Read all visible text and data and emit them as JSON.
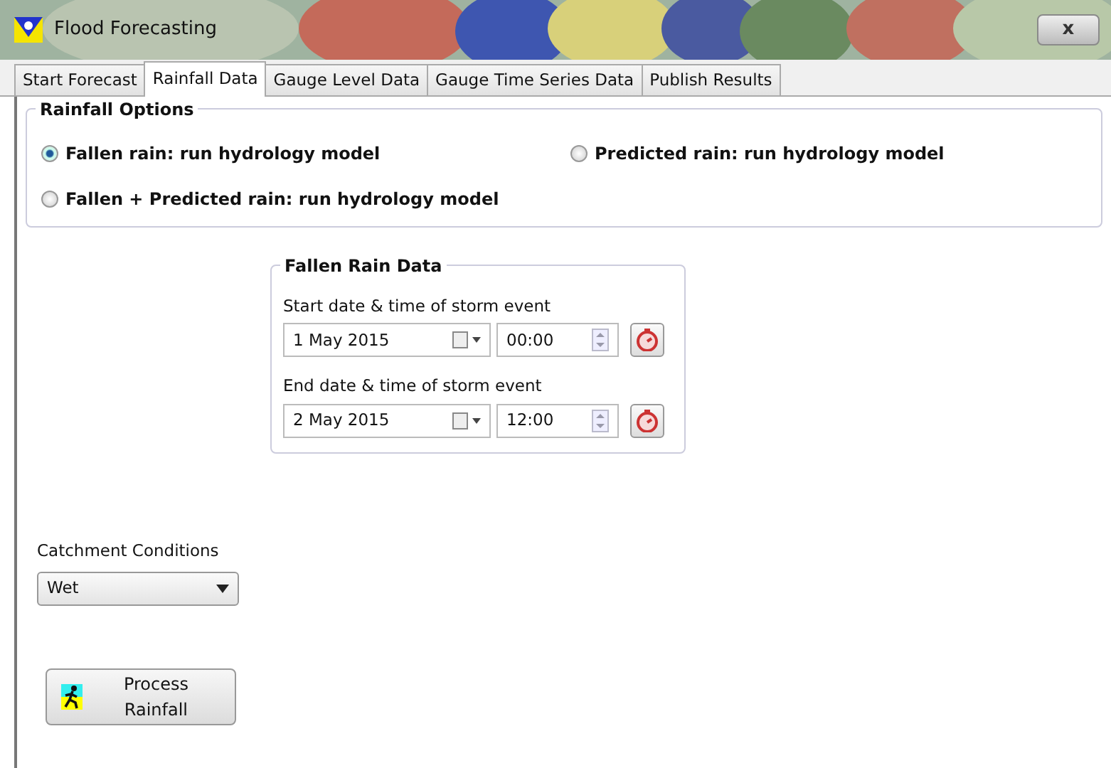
{
  "window": {
    "title": "Flood Forecasting",
    "close": "x"
  },
  "tabs": [
    {
      "label": "Start Forecast",
      "selected": false
    },
    {
      "label": "Rainfall Data",
      "selected": true
    },
    {
      "label": "Gauge Level Data",
      "selected": false
    },
    {
      "label": "Gauge Time Series Data",
      "selected": false
    },
    {
      "label": "Publish Results",
      "selected": false
    }
  ],
  "rainfall_options": {
    "title": "Rainfall Options",
    "options": [
      {
        "label": "Fallen rain: run hydrology model",
        "selected": true
      },
      {
        "label": "Predicted rain: run hydrology model",
        "selected": false
      },
      {
        "label": "Fallen + Predicted rain: run hydrology model",
        "selected": false
      }
    ]
  },
  "fallen_rain_data": {
    "title": "Fallen Rain Data",
    "rows": [
      {
        "label": "Start date & time of storm event",
        "date": "1 May 2015",
        "time": "00:00"
      },
      {
        "label": "End date & time of storm event",
        "date": "2 May 2015",
        "time": "12:00"
      }
    ]
  },
  "catchment_conditions": {
    "label": "Catchment Conditions",
    "value": "Wet"
  },
  "process_button": {
    "label": "Process Rainfall"
  }
}
